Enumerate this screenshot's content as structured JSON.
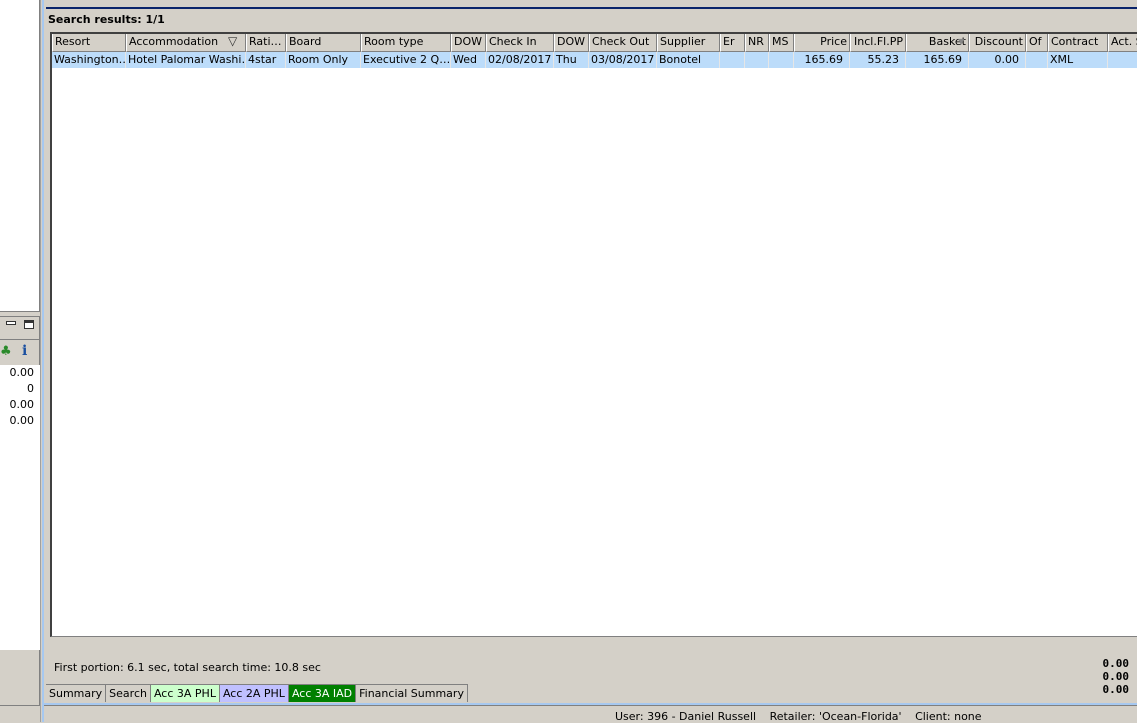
{
  "results_title": "Search results: 1/1",
  "columns": [
    "Resort",
    "Accommodation",
    "Rati…",
    "Board",
    "Room type",
    "DOW",
    "Check In",
    "DOW",
    "Check Out",
    "Supplier",
    "Er",
    "NR",
    "MS",
    "Price",
    "Incl.Fl.PP",
    "Basket",
    "Discount",
    "Of",
    "Contract",
    "Act. S"
  ],
  "rows": [
    [
      "Washington…",
      "Hotel Palomar Washi…",
      "4star",
      "Room Only",
      "Executive 2 Q…",
      "Wed",
      "02/08/2017",
      "Thu",
      "03/08/2017",
      "Bonotel",
      "",
      "",
      "",
      "165.69",
      "55.23",
      "165.69",
      "0.00",
      "",
      "XML",
      ""
    ]
  ],
  "left_panel": {
    "values": [
      "0.00",
      "0",
      "0.00",
      "0.00"
    ],
    "totals": [
      "0.00",
      "0.00",
      "0.00"
    ],
    "icons": [
      "palm-tree-icon",
      "info-icon"
    ]
  },
  "status_text": "First portion: 6.1 sec, total search time: 10.8 sec",
  "tabs": [
    {
      "label": "Summary",
      "bg": "#d4d0c8",
      "fg": "#000000"
    },
    {
      "label": "Search",
      "bg": "#d4d0c8",
      "fg": "#000000"
    },
    {
      "label": "Acc 3A PHL",
      "bg": "#ccffcc",
      "fg": "#000000"
    },
    {
      "label": "Acc 2A PHL",
      "bg": "#c0c0ff",
      "fg": "#000000"
    },
    {
      "label": "Acc 3A IAD",
      "bg": "#008000",
      "fg": "#ffffff"
    },
    {
      "label": "Financial Summary",
      "bg": "#d4d0c8",
      "fg": "#000000"
    }
  ],
  "user_bar": {
    "user": "User: 396 - Daniel Russell",
    "retailer": "Retailer: 'Ocean-Florida'",
    "client": "Client: none"
  },
  "colors": {
    "selection": "#bcdcfa",
    "accent": "#0a246a"
  }
}
